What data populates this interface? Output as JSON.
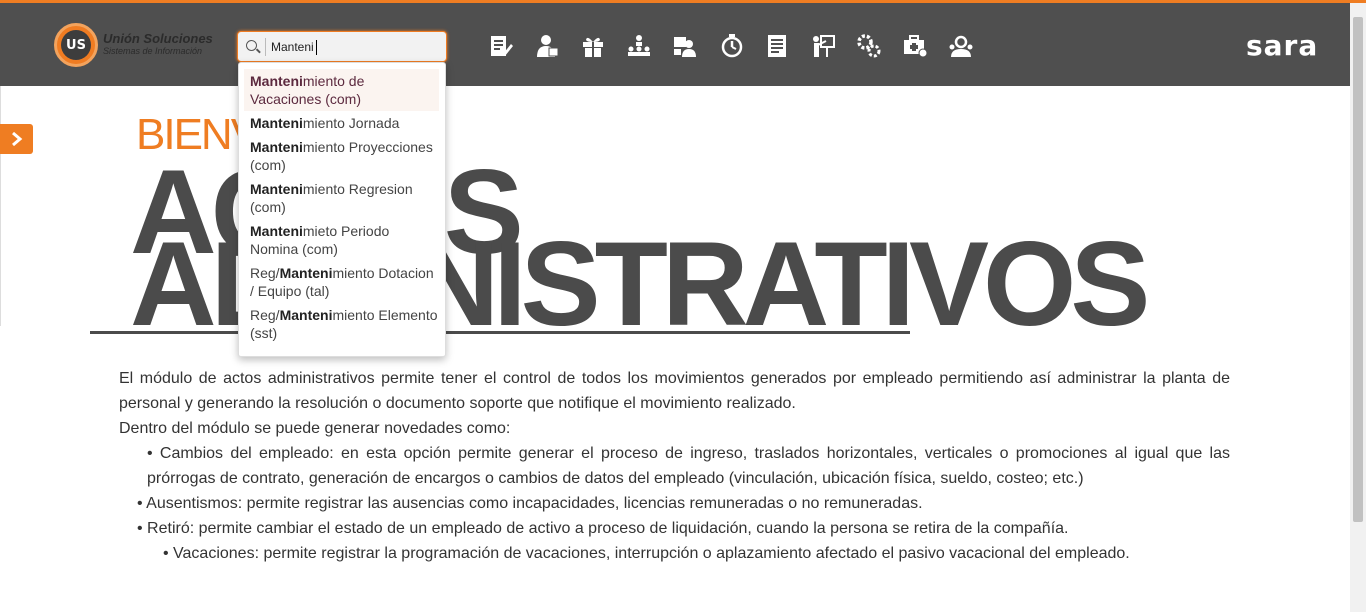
{
  "header": {
    "logo_title": "Unión Soluciones",
    "logo_subtitle": "Sistemas de Información",
    "logo_mark": "US",
    "brand": "sara",
    "accent_color": "#ef7d22",
    "bar_color": "#4f4f4f"
  },
  "search": {
    "value": "Manteni",
    "icon": "search-icon"
  },
  "nav_icons": [
    "document-edit-icon",
    "user-tie-icon",
    "gift-icon",
    "org-chart-icon",
    "user-id-card-icon",
    "stopwatch-icon",
    "report-sheet-icon",
    "presentation-board-icon",
    "gears-icon",
    "medical-kit-icon",
    "group-support-icon"
  ],
  "suggestions": [
    {
      "prefix": "",
      "match": "Manteni",
      "rest": "miento de Vacaciones (com)"
    },
    {
      "prefix": "",
      "match": "Manteni",
      "rest": "miento Jornada"
    },
    {
      "prefix": "",
      "match": "Manteni",
      "rest": "miento Proyecciones (com)"
    },
    {
      "prefix": "",
      "match": "Manteni",
      "rest": "miento Regresion (com)"
    },
    {
      "prefix": "",
      "match": "Manteni",
      "rest": "mieto Periodo Nomina (com)"
    },
    {
      "prefix": "Reg/",
      "match": "Manteni",
      "rest": "miento Dotacion / Equipo (tal)"
    },
    {
      "prefix": "Reg/",
      "match": "Manteni",
      "rest": "miento Elemento (sst)"
    }
  ],
  "hero": {
    "welcome": "BIENV",
    "title_line1": "ACTOS",
    "title_line2": "ADMINISTRATIVOS"
  },
  "content": {
    "p1": "El módulo de actos administrativos permite tener el control de todos los movimientos generados por empleado permitiendo así administrar la planta de personal y generando la resolución o documento soporte que notifique el movimiento realizado.",
    "p2": "Dentro del módulo se puede generar novedades como:",
    "b1": "•  Cambios del empleado: en esta opción permite generar el proceso de ingreso, traslados horizontales, verticales o promociones al igual que las prórrogas de contrato, generación de encargos o cambios de datos del empleado (vinculación, ubicación física, sueldo, costeo; etc.)",
    "b2": "•  Ausentismos: permite registrar las ausencias como incapacidades, licencias remuneradas o no remuneradas.",
    "b3": "•  Retiró: permite cambiar el estado de un empleado de activo a proceso de liquidación, cuando la persona se retira de la compañía.",
    "b4": "•  Vacaciones: permite registrar la programación de vacaciones, interrupción o aplazamiento afectado el pasivo vacacional del empleado."
  }
}
